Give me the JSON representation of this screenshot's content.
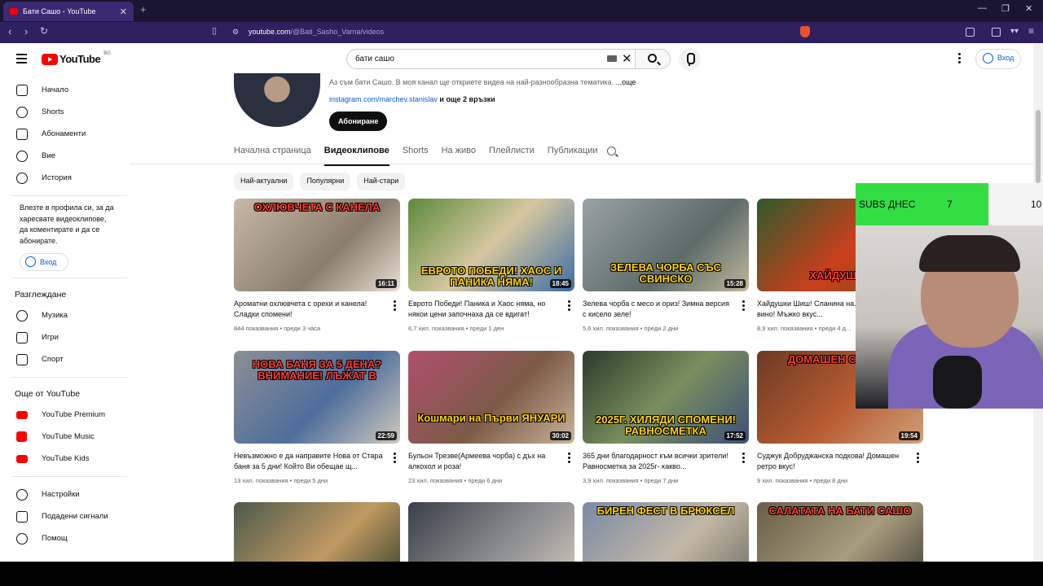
{
  "browser": {
    "tab_title": "Бати Сашо - YouTube",
    "url_host": "youtube.com",
    "url_path": "/@Bati_Sasho_Varna/videos",
    "new_tab": "+"
  },
  "header": {
    "logo_text": "YouTube",
    "region": "BG",
    "search_value": "бати сашо",
    "signin_label": "Вход"
  },
  "sidebar": {
    "main": [
      {
        "label": "Начало",
        "icon": "home-icon"
      },
      {
        "label": "Shorts",
        "icon": "shorts-icon"
      },
      {
        "label": "Абонаменти",
        "icon": "subscriptions-icon"
      }
    ],
    "you": [
      {
        "label": "Вие",
        "icon": "user-icon"
      },
      {
        "label": "История",
        "icon": "history-icon"
      }
    ],
    "signin_prompt": "Влезте в профила си, за да харесвате видеоклипове, да коментирате и да се абонирате.",
    "signin_label": "Вход",
    "explore_heading": "Разглеждане",
    "explore": [
      {
        "label": "Музика",
        "icon": "music-icon"
      },
      {
        "label": "Игри",
        "icon": "games-icon"
      },
      {
        "label": "Спорт",
        "icon": "trophy-icon"
      }
    ],
    "more_heading": "Още от YouTube",
    "more": [
      {
        "label": "YouTube Premium"
      },
      {
        "label": "YouTube Music"
      },
      {
        "label": "YouTube Kids"
      }
    ],
    "settings": [
      {
        "label": "Настройки",
        "icon": "gear-icon"
      },
      {
        "label": "Подадени сигнали",
        "icon": "flag-icon"
      },
      {
        "label": "Помощ",
        "icon": "help-icon"
      }
    ]
  },
  "channel": {
    "description": "Аз съм бати Сашо. В моя канал ще откриете видеа на най-разнообразна тематика.",
    "more": "...още",
    "link": "instagram.com/marchev.stanislav",
    "more_links": "и още 2 връзки",
    "subscribe": "Абониране"
  },
  "tabs": [
    "Начална страница",
    "Видеоклипове",
    "Shorts",
    "На живо",
    "Плейлисти",
    "Публикации"
  ],
  "chips": [
    "Най-актуални",
    "Популярни",
    "Най-стари"
  ],
  "videos": [
    {
      "title": "Ароматни охлювчета с орехи и канела! Сладки спомени!",
      "views": "844 показвания",
      "age": "преди 3 часа",
      "duration": "16:11",
      "thumb_text": "ОХЛЮВЧЕТА С КАНЕЛА"
    },
    {
      "title": "Еврото Победи! Паника и Хаос няма, но някои цени започнаха да се вдигат!",
      "views": "6,7 хил. показвания",
      "age": "преди 1 ден",
      "duration": "18:45",
      "thumb_text": "ЕВРОТО ПОБЕДИ! ХАОС И ПАНИКА НЯМА!"
    },
    {
      "title": "Зелева чорба с месо и ориз! Зимна версия с кисело зеле!",
      "views": "5,6 хил. показвания",
      "age": "преди 2 дни",
      "duration": "15:28",
      "thumb_text": "ЗЕЛЕВА ЧОРБА СЪС СВИНСКО"
    },
    {
      "title": "Хайдушки Шиш! Сланина на... червено вино! Мъжко вкус...",
      "views": "8,9 хил. показвания",
      "age": "преди 4 д...",
      "duration": "",
      "thumb_text": "ХАЙДУШКИ"
    },
    {
      "title": "Невъзможно е да направите Нова от Стара баня за 5 дни! Който Ви обещае щ...",
      "views": "13 хил. показвания",
      "age": "преди 5 дни",
      "duration": "22:59",
      "thumb_text": "НОВА БАНЯ ЗА 5 ДЕНА? ВНИМАНИЕ! ЛЪЖАТ В"
    },
    {
      "title": "Бульон Трезве(Армеева чорба) с дъх на алкохол и роза!",
      "views": "23 хил. показвания",
      "age": "преди 6 дни",
      "duration": "30:02",
      "thumb_text": "Кошмари на Първи ЯНУАРИ"
    },
    {
      "title": "365 дни благодарност към всички зрители! Равносметка за 2025г- какво...",
      "views": "3,9 хил. показвания",
      "age": "преди 7 дни",
      "duration": "17:52",
      "thumb_text": "2025Г. ХИЛЯДИ СПОМЕНИ! РАВНОСМЕТКА"
    },
    {
      "title": "Суджук Добруджанска подкова! Домашен ретро вкус!",
      "views": "9 хил. показвания",
      "age": "преди 8 дни",
      "duration": "19:54",
      "thumb_text": "ДОМАШЕН СУДЖУК"
    },
    {
      "title": "",
      "views": "",
      "age": "",
      "duration": "",
      "thumb_text": ""
    },
    {
      "title": "",
      "views": "",
      "age": "",
      "duration": "",
      "thumb_text": ""
    },
    {
      "title": "",
      "views": "",
      "age": "",
      "duration": "",
      "thumb_text": "БИРЕН ФЕСТ В БРЮКСЕЛ"
    },
    {
      "title": "",
      "views": "",
      "age": "",
      "duration": "",
      "thumb_text": "САЛАТАТА НА БАТИ САШО"
    }
  ],
  "overlay": {
    "subs_label": "SUBS ДНЕС",
    "subs_value": "7",
    "goal_value": "10"
  },
  "colors": {
    "accent": "#ff0000",
    "link": "#065fd4",
    "overlay_green": "#33dd44",
    "browser_bar": "#2f2060"
  }
}
